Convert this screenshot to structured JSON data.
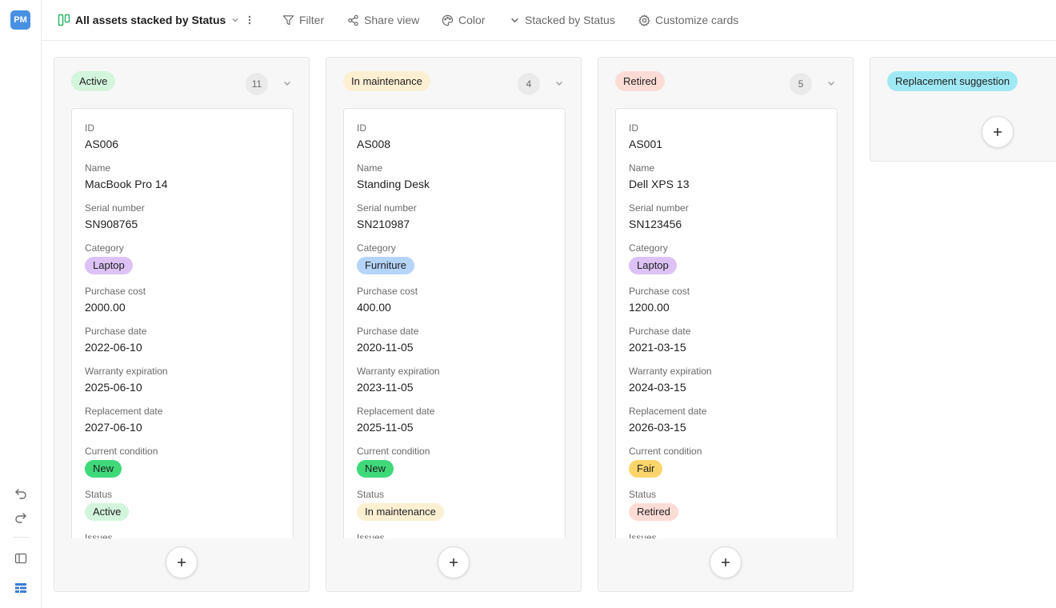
{
  "app": {
    "logo": "PM"
  },
  "toolbar": {
    "view_name": "All assets stacked by Status",
    "filter_label": "Filter",
    "share_label": "Share view",
    "color_label": "Color",
    "stacked_label": "Stacked by Status",
    "customize_label": "Customize cards"
  },
  "field_labels": {
    "id": "ID",
    "name": "Name",
    "serial": "Serial number",
    "category": "Category",
    "cost": "Purchase cost",
    "purchase_date": "Purchase date",
    "warranty": "Warranty expiration",
    "replacement": "Replacement date",
    "condition": "Current condition",
    "status": "Status",
    "issues": "Issues"
  },
  "colors": {
    "active": "#d3f5dc",
    "maintenance": "#fdf0d2",
    "retired": "#fddcd6",
    "suggestion": "#9fe9f5",
    "laptop": "#dcc2f5",
    "furniture": "#b5d4f9",
    "new": "#3fd97a",
    "fair": "#fbd56b"
  },
  "columns": [
    {
      "status": "Active",
      "count": "11",
      "card": {
        "id": "AS006",
        "name": "MacBook Pro 14",
        "serial": "SN908765",
        "category": "Laptop",
        "cost": "2000.00",
        "purchase_date": "2022-06-10",
        "warranty": "2025-06-10",
        "replacement": "2027-06-10",
        "condition": "New",
        "status": "Active"
      }
    },
    {
      "status": "In maintenance",
      "count": "4",
      "card": {
        "id": "AS008",
        "name": "Standing Desk",
        "serial": "SN210987",
        "category": "Furniture",
        "cost": "400.00",
        "purchase_date": "2020-11-05",
        "warranty": "2023-11-05",
        "replacement": "2025-11-05",
        "condition": "New",
        "status": "In maintenance"
      }
    },
    {
      "status": "Retired",
      "count": "5",
      "card": {
        "id": "AS001",
        "name": "Dell XPS 13",
        "serial": "SN123456",
        "category": "Laptop",
        "cost": "1200.00",
        "purchase_date": "2021-03-15",
        "warranty": "2024-03-15",
        "replacement": "2026-03-15",
        "condition": "Fair",
        "status": "Retired"
      }
    },
    {
      "status": "Replacement suggestion"
    }
  ]
}
